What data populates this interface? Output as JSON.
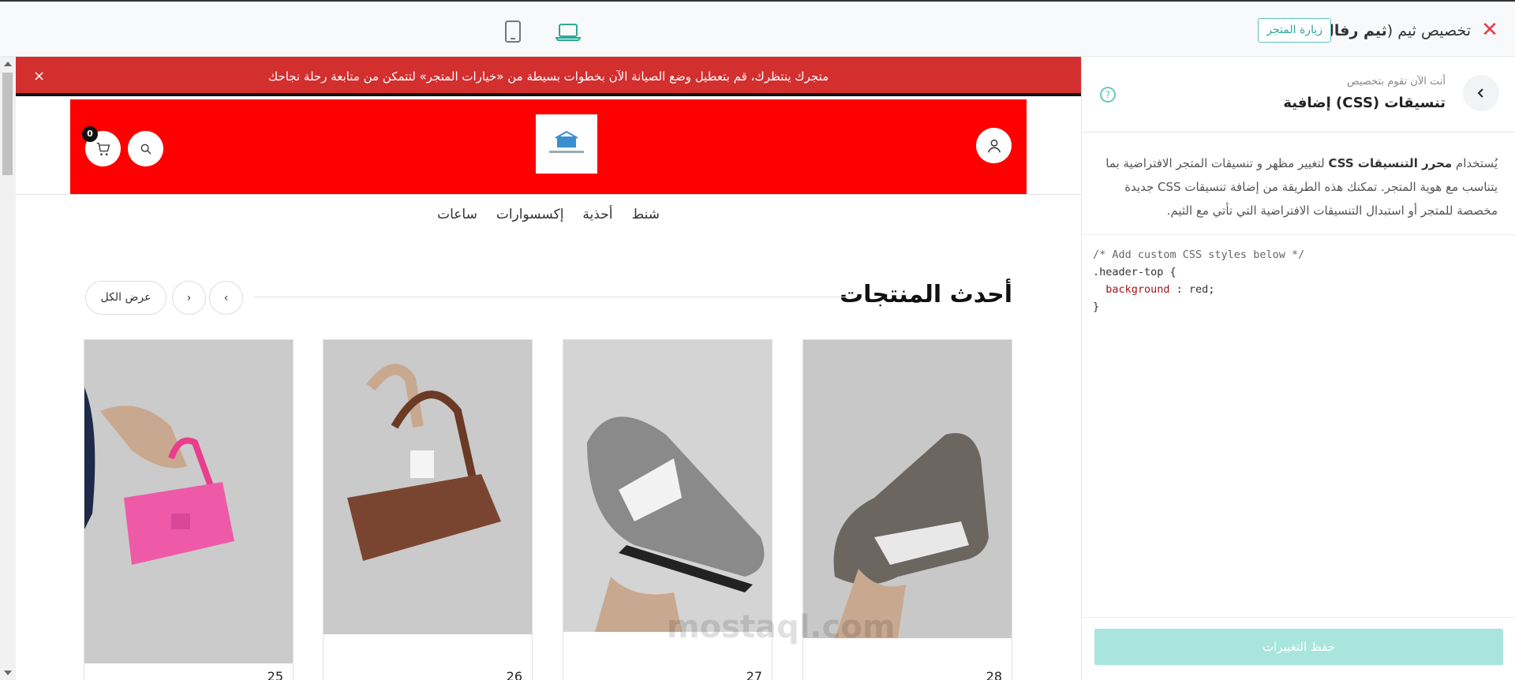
{
  "topbar": {
    "title_prefix": "تخصيص ثيم",
    "theme_name": "ثيم رفال",
    "visit_store": "زيارة المتجر",
    "accent": "#2fa896"
  },
  "notice": {
    "text": "متجرك ينتظرك، قم بتعطيل وضع الصيانة الآن بخطوات بسيطة من «خيارات المتجر» لتتمكن من متابعة رحلة نجاحك",
    "close": "×",
    "color": "#d32f2f"
  },
  "header": {
    "background": "red",
    "cart_count": "0"
  },
  "nav": {
    "items": [
      "شنط",
      "أحذية",
      "إكسسوارات",
      "ساعات"
    ]
  },
  "section": {
    "title": "أحدث المنتجات",
    "view_all": "عرض الكل"
  },
  "products": [
    {
      "price": "28",
      "image": "grey running sneaker"
    },
    {
      "price": "27",
      "image": "grey sneaker with white N"
    },
    {
      "price": "26",
      "image": "brown long handbag"
    },
    {
      "price": "25",
      "image": "pink mini handbag"
    }
  ],
  "watermark": "mostaql.com",
  "panel": {
    "sub_label": "أنت الآن تقوم بتخصيص",
    "title": "تنسيقات (CSS) إضافية",
    "desc_bold": "محرر التنسيقات CSS",
    "desc_pre": "يُستخدام",
    "desc_post": "لتغيير مظهر و تنسيقات المتجر الافتراضية بما يتناسب مع هوية المتجر. تمكنك هذه الطريقة من إضافة تنسيقات CSS جديدة مخصصة للمتجر أو استبدال التنسيقات الافتراضية التي تأتي مع الثيم.",
    "code_comment": "/* Add custom CSS styles below */",
    "code_selector": ".header-top {",
    "code_prop": "background",
    "code_value": " : red;",
    "code_close": "}",
    "save_label": "حفظ التغييرات"
  }
}
